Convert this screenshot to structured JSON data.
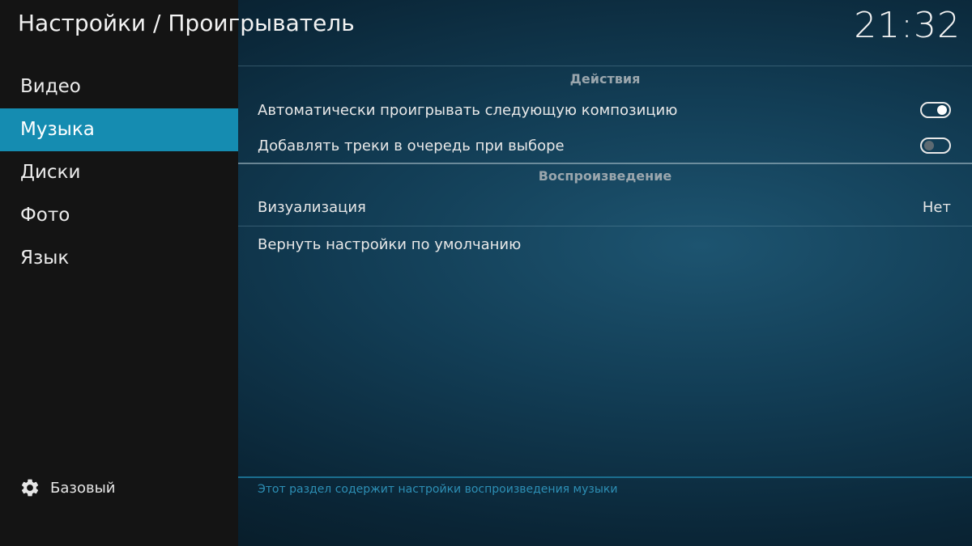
{
  "header": {
    "title": "Настройки / Проигрыватель",
    "clock": "21:32"
  },
  "sidebar": {
    "items": [
      {
        "label": "Видео",
        "active": false
      },
      {
        "label": "Музыка",
        "active": true
      },
      {
        "label": "Диски",
        "active": false
      },
      {
        "label": "Фото",
        "active": false
      },
      {
        "label": "Язык",
        "active": false
      }
    ],
    "level": {
      "icon": "gear-icon",
      "label": "Базовый"
    }
  },
  "main": {
    "sections": [
      {
        "title": "Действия",
        "settings": [
          {
            "label": "Автоматически проигрывать следующую композицию",
            "type": "toggle",
            "value": true
          },
          {
            "label": "Добавлять треки в очередь при выборе",
            "type": "toggle",
            "value": false
          }
        ]
      },
      {
        "title": "Воспроизведение",
        "settings": [
          {
            "label": "Визуализация",
            "type": "value",
            "value": "Нет"
          },
          {
            "label": "Вернуть настройки по умолчанию",
            "type": "action"
          }
        ]
      }
    ],
    "description": "Этот раздел содержит настройки воспроизведения музыки"
  },
  "colors": {
    "accent": "#158cb1",
    "sidebar_bg": "#141414",
    "footer_text": "#2d8fb5"
  }
}
